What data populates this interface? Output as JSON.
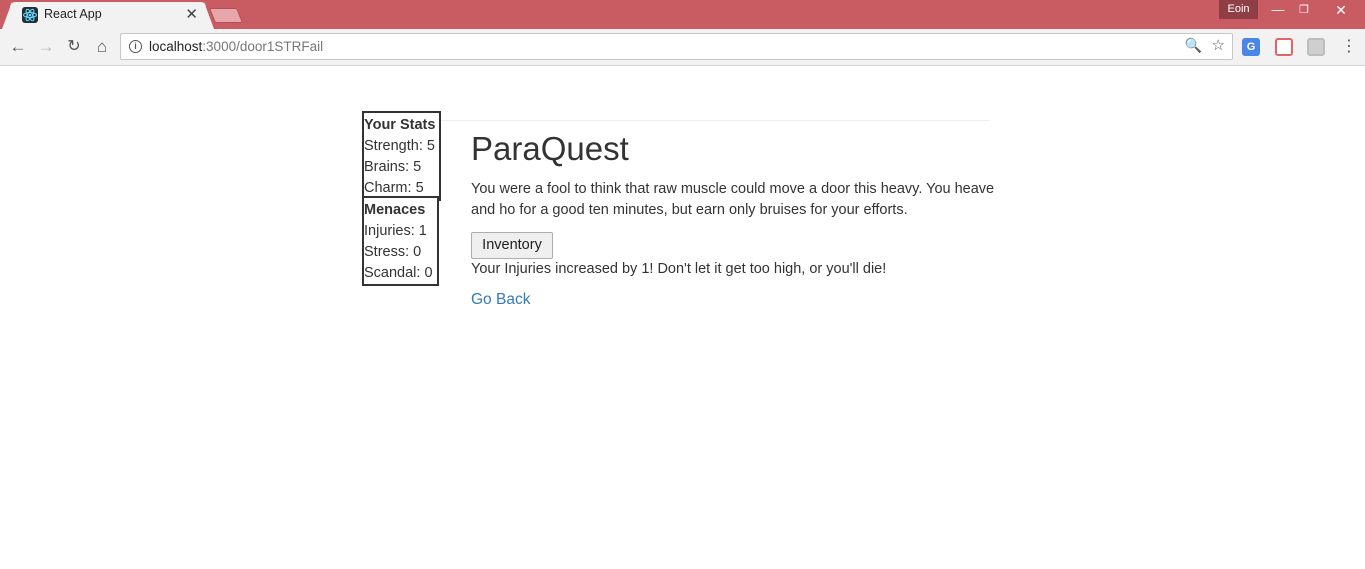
{
  "browser": {
    "tab_title": "React App",
    "tab_close": "✕",
    "user_name": "Eoin",
    "url_host": "localhost",
    "url_rest": ":3000/door1STRFail",
    "window_min": "—",
    "window_max": "❐",
    "window_close": "✕",
    "icons": {
      "back": "←",
      "forward": "→",
      "reload": "↻",
      "home": "⌂",
      "info": "i",
      "zoom": "🔍",
      "star": "☆",
      "translate": "G",
      "menu": "⋮"
    }
  },
  "stats": {
    "title": "Your Stats",
    "lines": [
      "Strength: 5",
      "Brains: 5",
      "Charm: 5"
    ]
  },
  "menaces": {
    "title": "Menaces",
    "lines": [
      "Injuries: 1",
      "Stress: 0",
      "Scandal: 0"
    ]
  },
  "main": {
    "title": "ParaQuest",
    "story": "You were a fool to think that raw muscle could move a door this heavy. You heave and ho for a good ten minutes, but earn only bruises for your efforts.",
    "inventory_label": "Inventory",
    "notice": "Your Injuries increased by 1! Don't let it get too high, or you'll die!",
    "go_back_label": "Go Back"
  },
  "colors": {
    "titlebar": "#c95c63",
    "link": "#337ab7",
    "text": "#333333"
  }
}
